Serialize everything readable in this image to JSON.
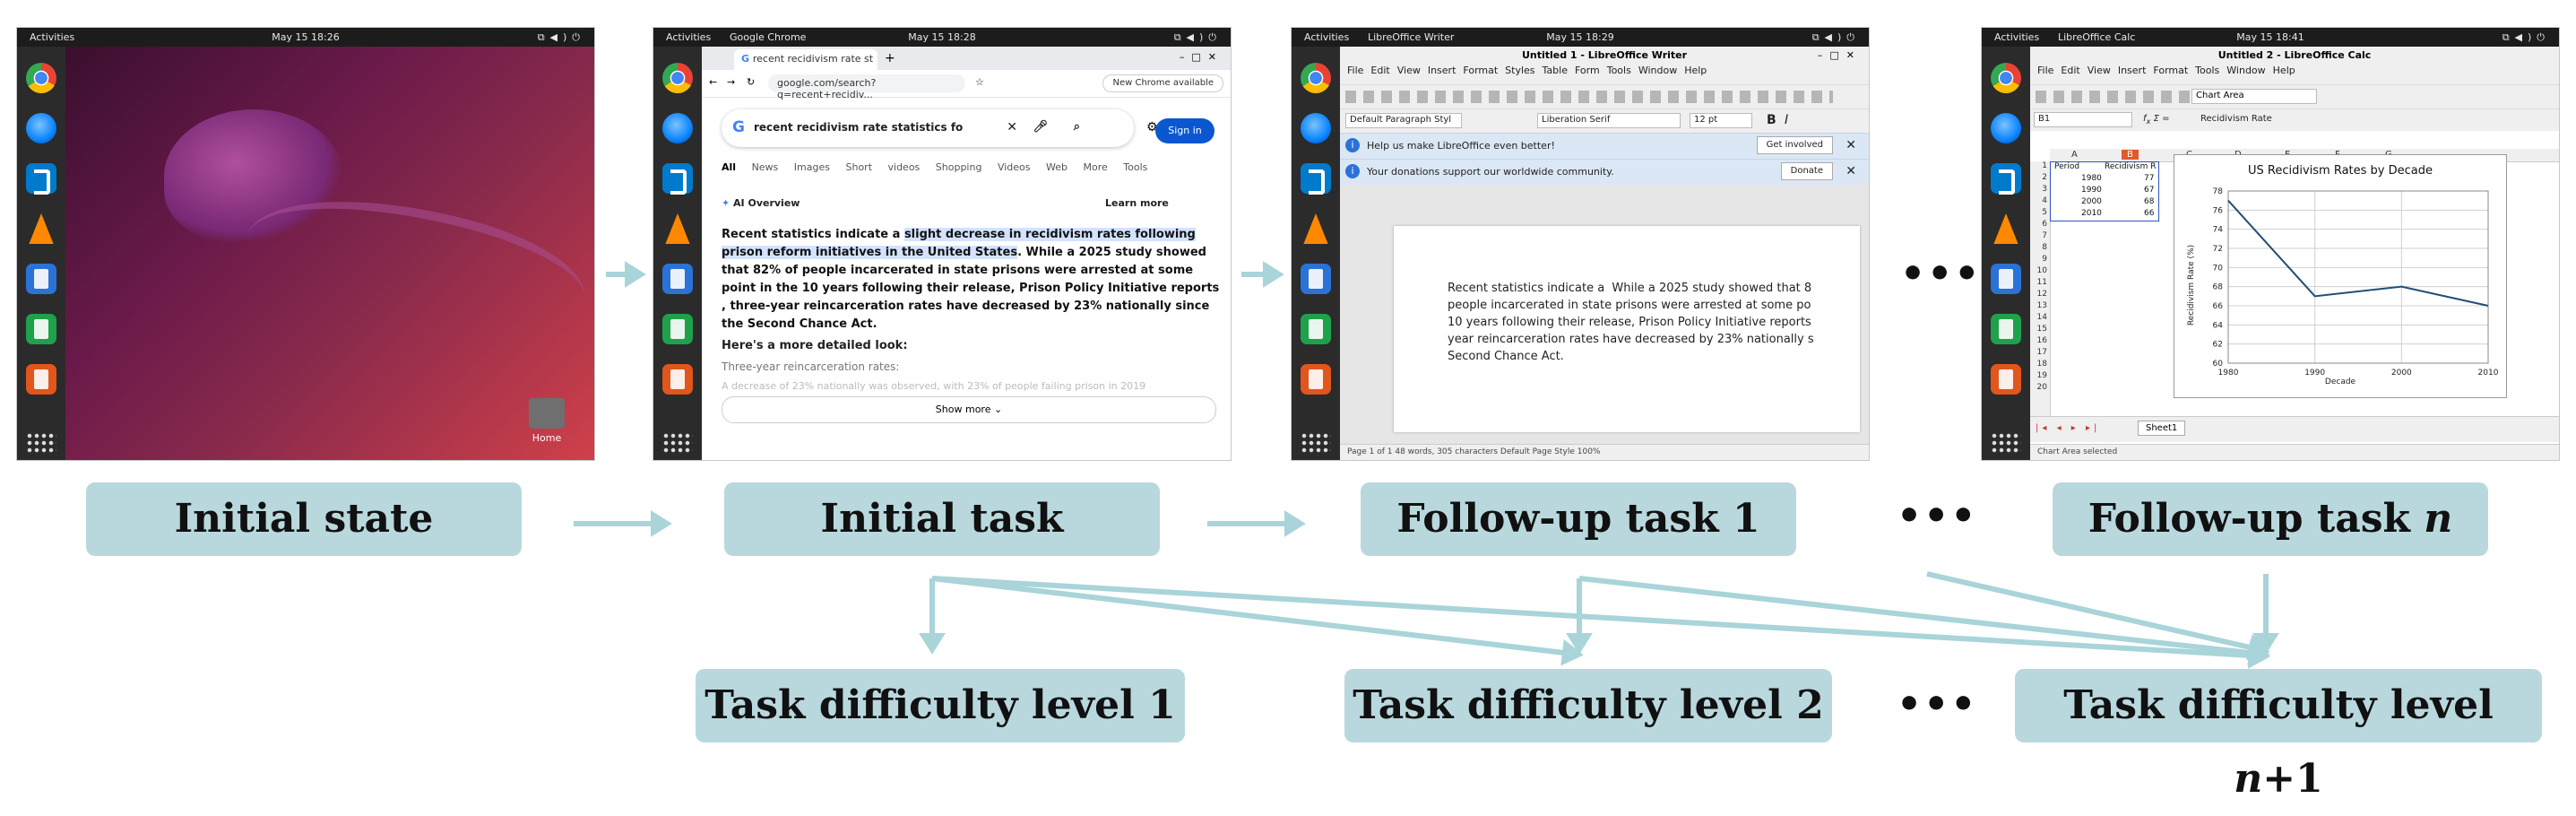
{
  "colors": {
    "arrow": "#a9d4d9",
    "label_bg": "#b9d8de"
  },
  "panels": {
    "desktop": {
      "topbar": {
        "activities": "Activities",
        "clock": "May 15  18:26"
      },
      "home_label": "Home"
    },
    "chrome": {
      "topbar": {
        "activities": "Activities",
        "app": "Google Chrome",
        "clock": "May 15  18:28"
      },
      "tab_title": "recent recidivism rate st",
      "url": "google.com/search?q=recent+recidiv...",
      "new_chrome": "New Chrome available",
      "query": "recent recidivism rate statistics fo",
      "sign_in": "Sign in",
      "nav_tabs": [
        "All",
        "News",
        "Images",
        "Short videos",
        "Shopping",
        "Videos",
        "Web",
        "More",
        "Tools"
      ],
      "ai_overview": "AI Overview",
      "learn_more": "Learn more",
      "ai_text_before": "Recent statistics indicate a ",
      "ai_text_highlight": "slight decrease in recidivism rates following prison reform initiatives in the United States",
      "ai_text_after": ". While a 2025 study showed that 82% of people incarcerated in state prisons were arrested at some point in the 10 years following their release, Prison Policy Initiative reports , three-year reincarceration rates have decreased by 23% nationally since the Second Chance Act.",
      "more_heading": "Here's a more detailed look:",
      "sub_heading": "Three-year reincarceration rates:",
      "faded_line": "A decrease of 23% nationally was observed, with 23% of people failing prison in 2019",
      "show_more": "Show more"
    },
    "writer": {
      "topbar": {
        "activities": "Activities",
        "app": "LibreOffice Writer",
        "clock": "May 15  18:29"
      },
      "window_title": "Untitled 1 - LibreOffice Writer",
      "menu": [
        "File",
        "Edit",
        "View",
        "Insert",
        "Format",
        "Styles",
        "Table",
        "Form",
        "Tools",
        "Window",
        "Help"
      ],
      "para_style": "Default Paragraph Styl",
      "font": "Liberation Serif",
      "size": "12 pt",
      "info1": "Help us make LibreOffice even better!",
      "info1_button": "Get involved",
      "info2": "Your donations support our worldwide community.",
      "info2_button": "Donate",
      "doc_text": "Recent statistics indicate a  While a 2025 study showed that 8\npeople incarcerated in state prisons were arrested at some po\n10 years following their release, Prison Policy Initiative reports\nyear reincarceration rates have decreased by 23% nationally s\nSecond Chance Act.",
      "status": "Page 1 of 1    48 words, 305 characters    Default Page Style      100%"
    },
    "calc": {
      "topbar": {
        "activities": "Activities",
        "app": "LibreOffice Calc",
        "clock": "May 15  18:41"
      },
      "window_title": "Untitled 2 - LibreOffice Calc",
      "menu": [
        "File",
        "Edit",
        "View",
        "Insert",
        "Format",
        "Tools",
        "Window",
        "Help"
      ],
      "name_box": "B1",
      "formula": "Recidivism Rate",
      "chart_area": "Chart Area",
      "columns": [
        "A",
        "B",
        "C",
        "D",
        "E",
        "F",
        "G"
      ],
      "cells": [
        [
          "Period",
          "Recidivism R"
        ],
        [
          "1980",
          "77"
        ],
        [
          "1990",
          "67"
        ],
        [
          "2000",
          "68"
        ],
        [
          "2010",
          "66"
        ]
      ],
      "sheet_tab": "Sheet1",
      "status": "Chart Area selected"
    }
  },
  "labels": {
    "initial_state": "Initial state",
    "initial_task": "Initial task",
    "follow_up_1": "Follow-up task 1",
    "follow_up_n": "Follow-up task ",
    "follow_up_n_var": "n",
    "level_1": "Task difficulty level 1",
    "level_2": "Task difficulty level 2",
    "level_n1": "Task difficulty level ",
    "level_n1_var": "n",
    "level_n1_suffix": "+1",
    "ellipsis": "•••"
  },
  "chart_data": {
    "type": "line",
    "title": "US Recidivism Rates by Decade",
    "xlabel": "Decade",
    "ylabel": "Recidivism Rate (%)",
    "x": [
      1980,
      1990,
      2000,
      2010
    ],
    "y": [
      77,
      67,
      68,
      66
    ],
    "xticks": [
      1980,
      1990,
      2000,
      2010
    ],
    "yticks": [
      60,
      62,
      64,
      66,
      68,
      70,
      72,
      74,
      76,
      78
    ],
    "xlim": [
      1980,
      2010
    ],
    "ylim": [
      60,
      78
    ],
    "grid": true
  }
}
